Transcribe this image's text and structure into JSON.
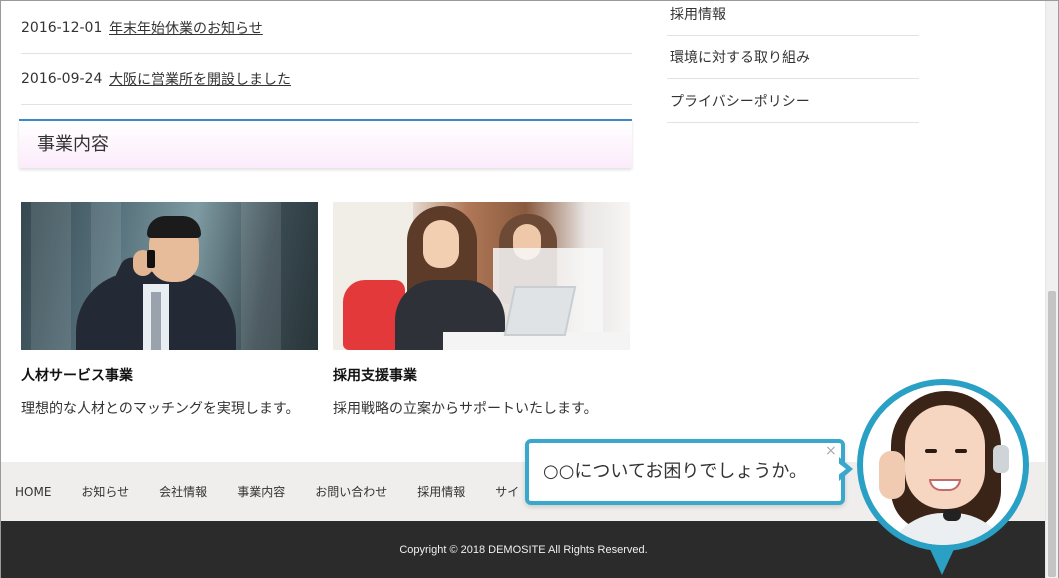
{
  "news": [
    {
      "date": "2016-12-01",
      "title": "年末年始休業のお知らせ"
    },
    {
      "date": "2016-09-24",
      "title": "大阪に営業所を開設しました"
    }
  ],
  "section": {
    "heading": "事業内容"
  },
  "business": [
    {
      "title": "人材サービス事業",
      "desc": "理想的な人材とのマッチングを実現します。"
    },
    {
      "title": "採用支援事業",
      "desc": "採用戦略の立案からサポートいたします。"
    }
  ],
  "sidebar": {
    "links": [
      "採用情報",
      "環境に対する取り組み",
      "プライバシーポリシー"
    ]
  },
  "footer": {
    "nav": [
      "HOME",
      "お知らせ",
      "会社情報",
      "事業内容",
      "お問い合わせ",
      "採用情報",
      "サイ"
    ],
    "copyright": "Copyright © 2018 DEMOSITE All Rights Reserved."
  },
  "chat": {
    "message": "○○についてお困りでしょうか。",
    "close": "×"
  },
  "colors": {
    "accent": "#3f87c6",
    "chat_border": "#3aa8cc",
    "footer_dark": "#2b2b2b"
  }
}
